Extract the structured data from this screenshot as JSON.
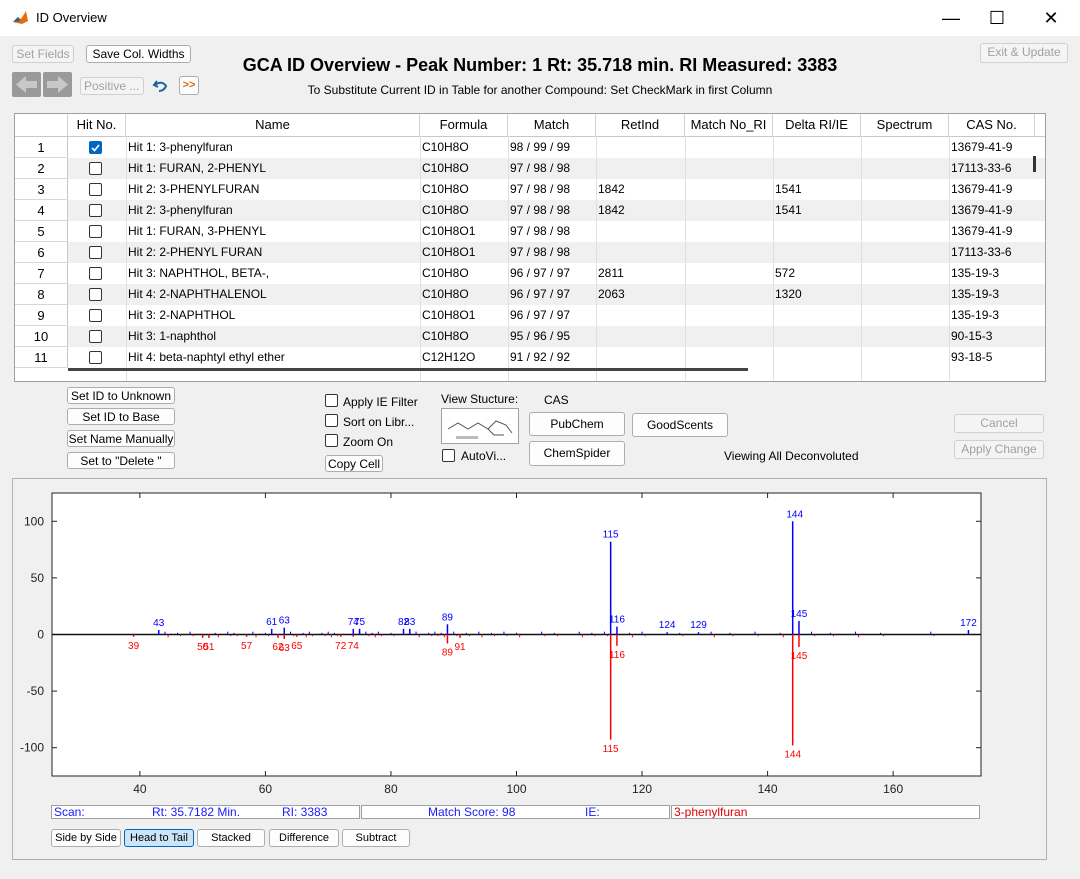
{
  "window": {
    "title": "ID Overview",
    "minimize": "—",
    "maximize": "☐",
    "close": "✕"
  },
  "toolbar": {
    "set_fields": "Set Fields",
    "save_col_widths": "Save Col. Widths",
    "positive": "Positive ...",
    "forward": ">>",
    "exit_update": "Exit & Update"
  },
  "header": {
    "title": "GCA ID Overview - Peak Number: 1  Rt: 35.718 min.  RI Measured: 3383",
    "subtitle": "To Substitute Current ID in Table for another Compound: Set CheckMark in first Column"
  },
  "table": {
    "columns": [
      "Hit No.",
      "Name",
      "Formula",
      "Match",
      "RetInd",
      "Match No_RI",
      "Delta RI/IE",
      "Spectrum",
      "CAS No."
    ],
    "rows": [
      {
        "n": "1",
        "checked": true,
        "name": "Hit  1: 3-phenylfuran",
        "formula": "C10H8O",
        "match": "98 / 99 / 99",
        "retind": "",
        "delta": "",
        "cas": "13679-41-9"
      },
      {
        "n": "2",
        "checked": false,
        "name": "Hit  1: FURAN, 2-PHENYL",
        "formula": "C10H8O",
        "match": "97 / 98 / 98",
        "retind": "",
        "delta": "",
        "cas": "17113-33-6"
      },
      {
        "n": "3",
        "checked": false,
        "name": "Hit  2: 3-PHENYLFURAN",
        "formula": "C10H8O",
        "match": "97 / 98 / 98",
        "retind": "1842",
        "delta": "1541",
        "cas": "13679-41-9"
      },
      {
        "n": "4",
        "checked": false,
        "name": "Hit  2: 3-phenylfuran",
        "formula": "C10H8O",
        "match": "97 / 98 / 98",
        "retind": "1842",
        "delta": "1541",
        "cas": "13679-41-9"
      },
      {
        "n": "5",
        "checked": false,
        "name": "Hit  1: FURAN, 3-PHENYL",
        "formula": "C10H8O1",
        "match": "97 / 98 / 98",
        "retind": "",
        "delta": "",
        "cas": "13679-41-9"
      },
      {
        "n": "6",
        "checked": false,
        "name": "Hit  2: 2-PHENYL FURAN",
        "formula": "C10H8O1",
        "match": "97 / 98 / 98",
        "retind": "",
        "delta": "",
        "cas": "17113-33-6"
      },
      {
        "n": "7",
        "checked": false,
        "name": "Hit  3: NAPHTHOL, BETA-,",
        "formula": "C10H8O",
        "match": "96 / 97 / 97",
        "retind": "2811",
        "delta": "572",
        "cas": "135-19-3"
      },
      {
        "n": "8",
        "checked": false,
        "name": "Hit  4: 2-NAPHTHALENOL",
        "formula": "C10H8O",
        "match": "96 / 97 / 97",
        "retind": "2063",
        "delta": "1320",
        "cas": "135-19-3"
      },
      {
        "n": "9",
        "checked": false,
        "name": "Hit  3: 2-NAPHTHOL",
        "formula": "C10H8O1",
        "match": "96 / 97 / 97",
        "retind": "",
        "delta": "",
        "cas": "135-19-3"
      },
      {
        "n": "10",
        "checked": false,
        "name": "Hit  3: 1-naphthol",
        "formula": "C10H8O",
        "match": "95 / 96 / 95",
        "retind": "",
        "delta": "",
        "cas": "90-15-3"
      },
      {
        "n": "11",
        "checked": false,
        "name": "Hit  4: beta-naphtyl ethyl ether",
        "formula": "C12H12O",
        "match": "91 / 92 / 92",
        "retind": "",
        "delta": "",
        "cas": "93-18-5"
      }
    ]
  },
  "controls": {
    "set_unknown": "Set ID to Unknown",
    "set_base": "Set ID to Base",
    "set_name": "Set Name Manually",
    "set_delete": "Set to \"Delete \"",
    "apply_ie": "Apply IE Filter",
    "sort_libr": "Sort on Libr...",
    "zoom_on": "Zoom On",
    "copy_cell": "Copy Cell",
    "view_structure": "View Stucture:",
    "cas": "CAS",
    "autovi": "AutoVi...",
    "pubchem": "PubChem",
    "goodscents": "GoodScents",
    "chemspider": "ChemSpider",
    "viewing": "Viewing All Deconvoluted",
    "cancel": "Cancel",
    "apply_change": "Apply Change"
  },
  "status": {
    "scan": "Scan:",
    "rt": "Rt: 35.7182 Min.",
    "ri": "RI: 3383",
    "match_score": "Match Score: 98",
    "ie": "IE:",
    "compound": "3-phenylfuran"
  },
  "view_buttons": [
    "Side by Side",
    "Head to Tail",
    "Stacked",
    "Difference",
    "Subtract"
  ],
  "chart_data": {
    "type": "bar",
    "xlim": [
      26,
      174
    ],
    "ylim": [
      -125,
      125
    ],
    "xticks": [
      40,
      60,
      80,
      100,
      120,
      140,
      160
    ],
    "yticks": [
      100,
      50,
      0,
      -50,
      -100
    ],
    "colors": {
      "top": "#0000ff",
      "bottom": "#ff0000"
    },
    "series": [
      {
        "name": "top",
        "x": [
          43,
          61,
          63,
          74,
          75,
          82,
          83,
          89,
          115,
          116,
          124,
          129,
          144,
          145,
          172
        ],
        "values": [
          4,
          5,
          6,
          5,
          5,
          5,
          5,
          9,
          82,
          7,
          2,
          2,
          100,
          12,
          4
        ]
      },
      {
        "name": "bottom",
        "x": [
          39,
          50,
          51,
          57,
          62,
          63,
          65,
          72,
          74,
          89,
          91,
          115,
          116,
          144,
          145
        ],
        "values": [
          -2,
          -3,
          -3,
          -2,
          -3,
          -4,
          -2,
          -2,
          -2,
          -8,
          -3,
          -93,
          -10,
          -98,
          -11
        ]
      }
    ],
    "labels_top": [
      "43",
      "61",
      "63",
      "74",
      "75",
      "82",
      "83",
      "89",
      "115",
      "116",
      "124",
      "129",
      "144",
      "145",
      "172"
    ],
    "labels_bottom": [
      "39",
      "50",
      "51",
      "57",
      "62",
      "63",
      "65",
      "72",
      "74",
      "89",
      "91",
      "115",
      "116",
      "144",
      "145"
    ]
  }
}
